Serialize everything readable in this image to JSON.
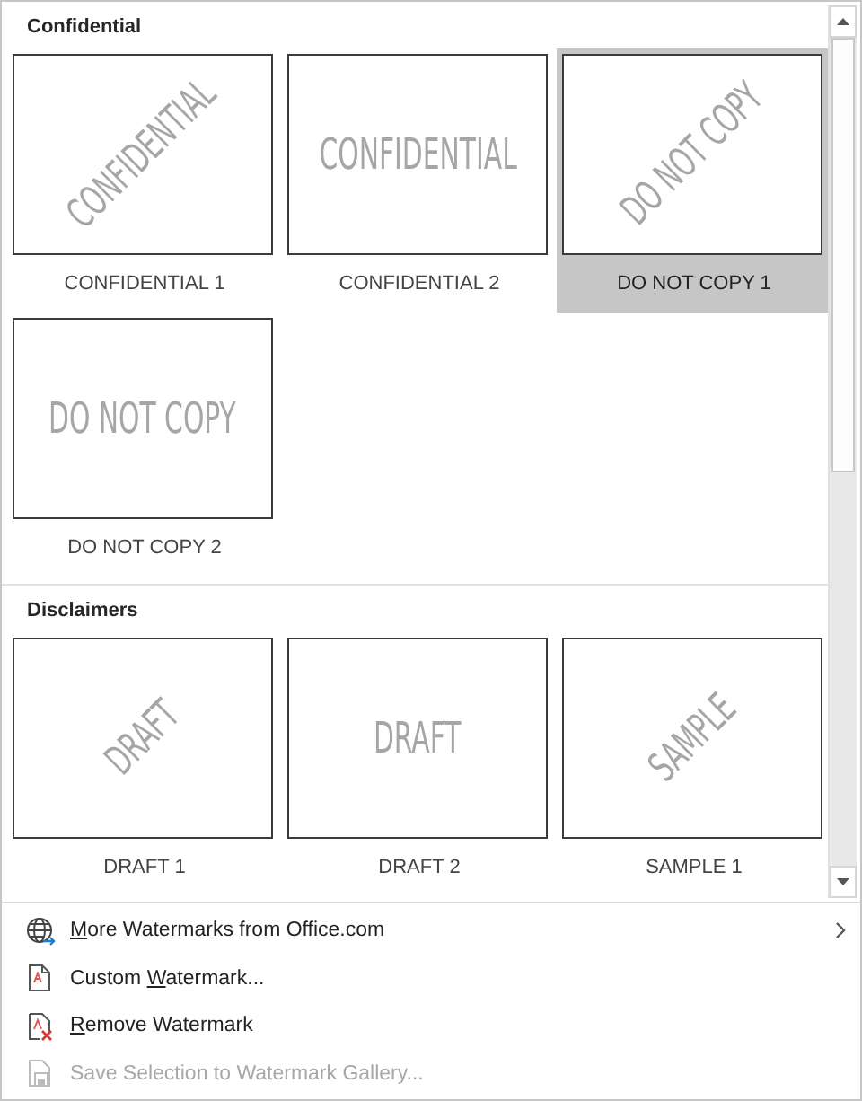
{
  "gallery": {
    "sections": [
      {
        "title": "Confidential",
        "items": [
          {
            "label": "CONFIDENTIAL 1",
            "preview_text": "CONFIDENTIAL",
            "kind": "diagonal",
            "selected": false
          },
          {
            "label": "CONFIDENTIAL 2",
            "preview_text": "CONFIDENTIAL",
            "kind": "horizontal",
            "selected": false
          },
          {
            "label": "DO NOT COPY 1",
            "preview_text": "DO NOT COPY",
            "kind": "diagonal",
            "selected": true
          },
          {
            "label": "DO NOT COPY 2",
            "preview_text": "DO NOT COPY",
            "kind": "horizontal",
            "selected": false
          }
        ]
      },
      {
        "title": "Disclaimers",
        "items": [
          {
            "label": "DRAFT 1",
            "preview_text": "DRAFT",
            "kind": "diagonal",
            "selected": false
          },
          {
            "label": "DRAFT 2",
            "preview_text": "DRAFT",
            "kind": "horizontal",
            "selected": false
          },
          {
            "label": "SAMPLE 1",
            "preview_text": "SAMPLE",
            "kind": "diagonal",
            "selected": false
          }
        ]
      }
    ]
  },
  "menu": [
    {
      "kind": "globe",
      "label_parts": [
        {
          "text": "M",
          "underlined": true
        },
        {
          "text": "ore Watermarks from Office.com",
          "underlined": false
        }
      ],
      "has_submenu": true,
      "disabled": false
    },
    {
      "kind": "document",
      "label_parts": [
        {
          "text": "Custom ",
          "underlined": false
        },
        {
          "text": "W",
          "underlined": true
        },
        {
          "text": "atermark...",
          "underlined": false
        }
      ],
      "has_submenu": false,
      "disabled": false
    },
    {
      "kind": "remove",
      "label_parts": [
        {
          "text": "R",
          "underlined": true
        },
        {
          "text": "emove Watermark",
          "underlined": false
        }
      ],
      "has_submenu": false,
      "disabled": false
    },
    {
      "kind": "save",
      "label_parts": [
        {
          "text": "Save Selection to Watermark Gallery...",
          "underlined": false
        }
      ],
      "has_submenu": false,
      "disabled": true
    }
  ]
}
